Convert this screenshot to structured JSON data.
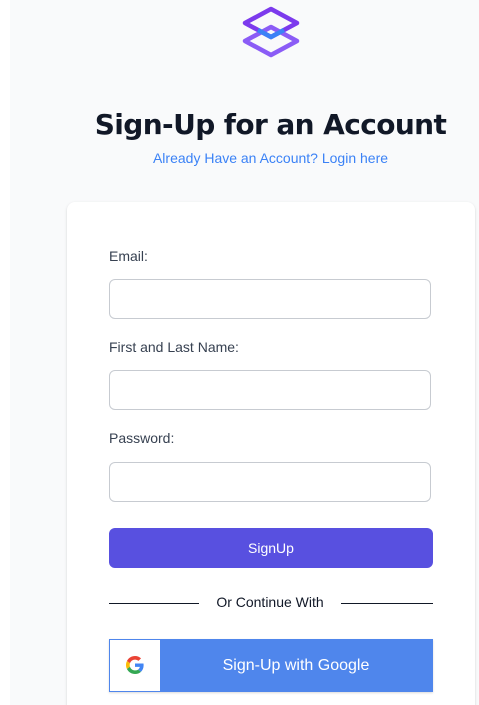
{
  "header": {
    "logo_icon": "hexagon-logo-icon",
    "title": "Sign-Up for an Account",
    "login_link": "Already Have an Account? Login here"
  },
  "form": {
    "email_label": "Email:",
    "email_value": "",
    "name_label": "First and Last Name:",
    "name_value": "",
    "password_label": "Password:",
    "password_value": "",
    "signup_button": "SignUp",
    "divider_text": "Or Continue With",
    "google_icon": "google-icon",
    "google_button": "Sign-Up with Google"
  },
  "colors": {
    "primary": "#5850e0",
    "link": "#3b82f6",
    "google_blue": "#4f86ec",
    "logo_purple": "#7c3aed",
    "logo_blue": "#3b82f6"
  }
}
